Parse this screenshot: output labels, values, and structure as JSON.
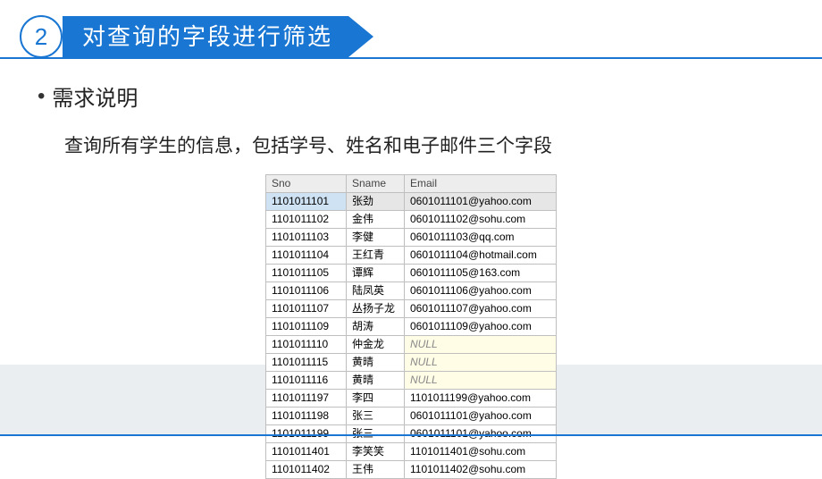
{
  "header": {
    "number": "2",
    "title": "对查询的字段进行筛选"
  },
  "bullet": "需求说明",
  "description": "查询所有学生的信息，包括学号、姓名和电子邮件三个字段",
  "table": {
    "columns": [
      "Sno",
      "Sname",
      "Email"
    ],
    "rows": [
      {
        "sno": "1101011101",
        "sname": "张劲",
        "email": "0601011101@yahoo.com",
        "selected": true
      },
      {
        "sno": "1101011102",
        "sname": "金伟",
        "email": "0601011102@sohu.com"
      },
      {
        "sno": "1101011103",
        "sname": "李健",
        "email": "0601011103@qq.com"
      },
      {
        "sno": "1101011104",
        "sname": "王红青",
        "email": "0601011104@hotmail.com"
      },
      {
        "sno": "1101011105",
        "sname": "谭辉",
        "email": "0601011105@163.com"
      },
      {
        "sno": "1101011106",
        "sname": "陆凤英",
        "email": "0601011106@yahoo.com"
      },
      {
        "sno": "1101011107",
        "sname": "丛扬子龙",
        "email": "0601011107@yahoo.com"
      },
      {
        "sno": "1101011109",
        "sname": "胡涛",
        "email": "0601011109@yahoo.com"
      },
      {
        "sno": "1101011110",
        "sname": "仲金龙",
        "email": "NULL",
        "null": true
      },
      {
        "sno": "1101011115",
        "sname": "黄晴",
        "email": "NULL",
        "null": true
      },
      {
        "sno": "1101011116",
        "sname": "黄晴",
        "email": "NULL",
        "null": true
      },
      {
        "sno": "1101011197",
        "sname": "李四",
        "email": "1101011199@yahoo.com"
      },
      {
        "sno": "1101011198",
        "sname": "张三",
        "email": "0601011101@yahoo.com"
      },
      {
        "sno": "1101011199",
        "sname": "张三",
        "email": "0601011101@yahoo.com"
      },
      {
        "sno": "1101011401",
        "sname": "李笑笑",
        "email": "1101011401@sohu.com"
      },
      {
        "sno": "1101011402",
        "sname": "王伟",
        "email": "1101011402@sohu.com"
      }
    ]
  }
}
